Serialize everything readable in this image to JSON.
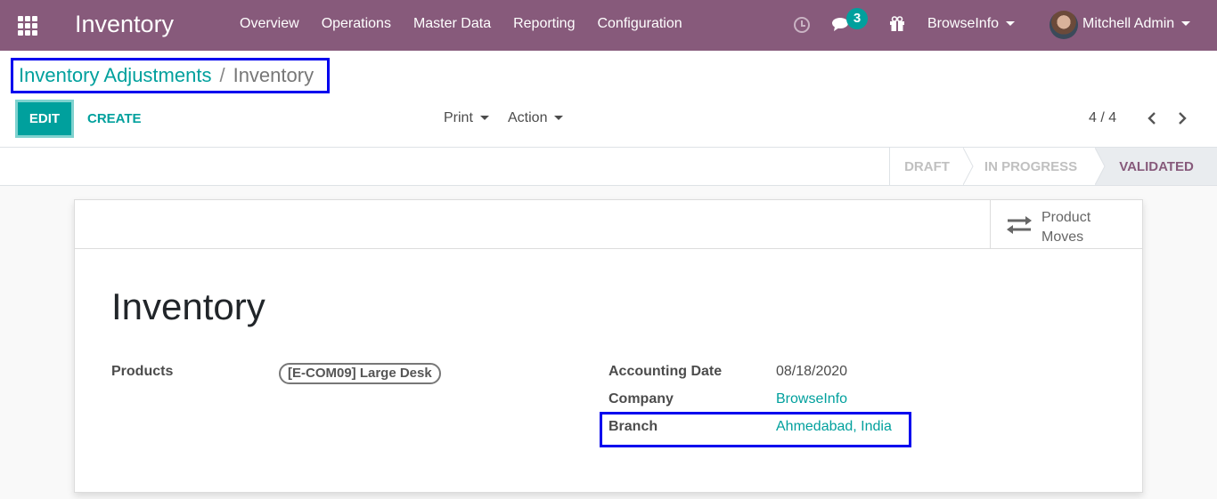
{
  "navbar": {
    "app_title": "Inventory",
    "menu": [
      "Overview",
      "Operations",
      "Master Data",
      "Reporting",
      "Configuration"
    ],
    "message_count": "3",
    "company": "BrowseInfo",
    "user": "Mitchell Admin",
    "color": "#875a7b"
  },
  "breadcrumb": {
    "parent": "Inventory Adjustments",
    "separator": "/",
    "current": "Inventory"
  },
  "toolbar": {
    "edit_label": "EDIT",
    "create_label": "CREATE",
    "print_label": "Print",
    "action_label": "Action",
    "pager": "4 / 4"
  },
  "statusbar": {
    "stages": [
      "DRAFT",
      "IN PROGRESS",
      "VALIDATED"
    ],
    "active": "VALIDATED"
  },
  "form": {
    "smart_button": {
      "line1": "Product",
      "line2": "Moves"
    },
    "title": "Inventory",
    "products_label": "Products",
    "product_tag": "[E-COM09] Large Desk",
    "accounting_date_label": "Accounting Date",
    "accounting_date": "08/18/2020",
    "company_label": "Company",
    "company": "BrowseInfo",
    "branch_label": "Branch",
    "branch": "Ahmedabad, India"
  },
  "colors": {
    "accent": "#00a09d",
    "highlight_box": "#0000ee"
  }
}
